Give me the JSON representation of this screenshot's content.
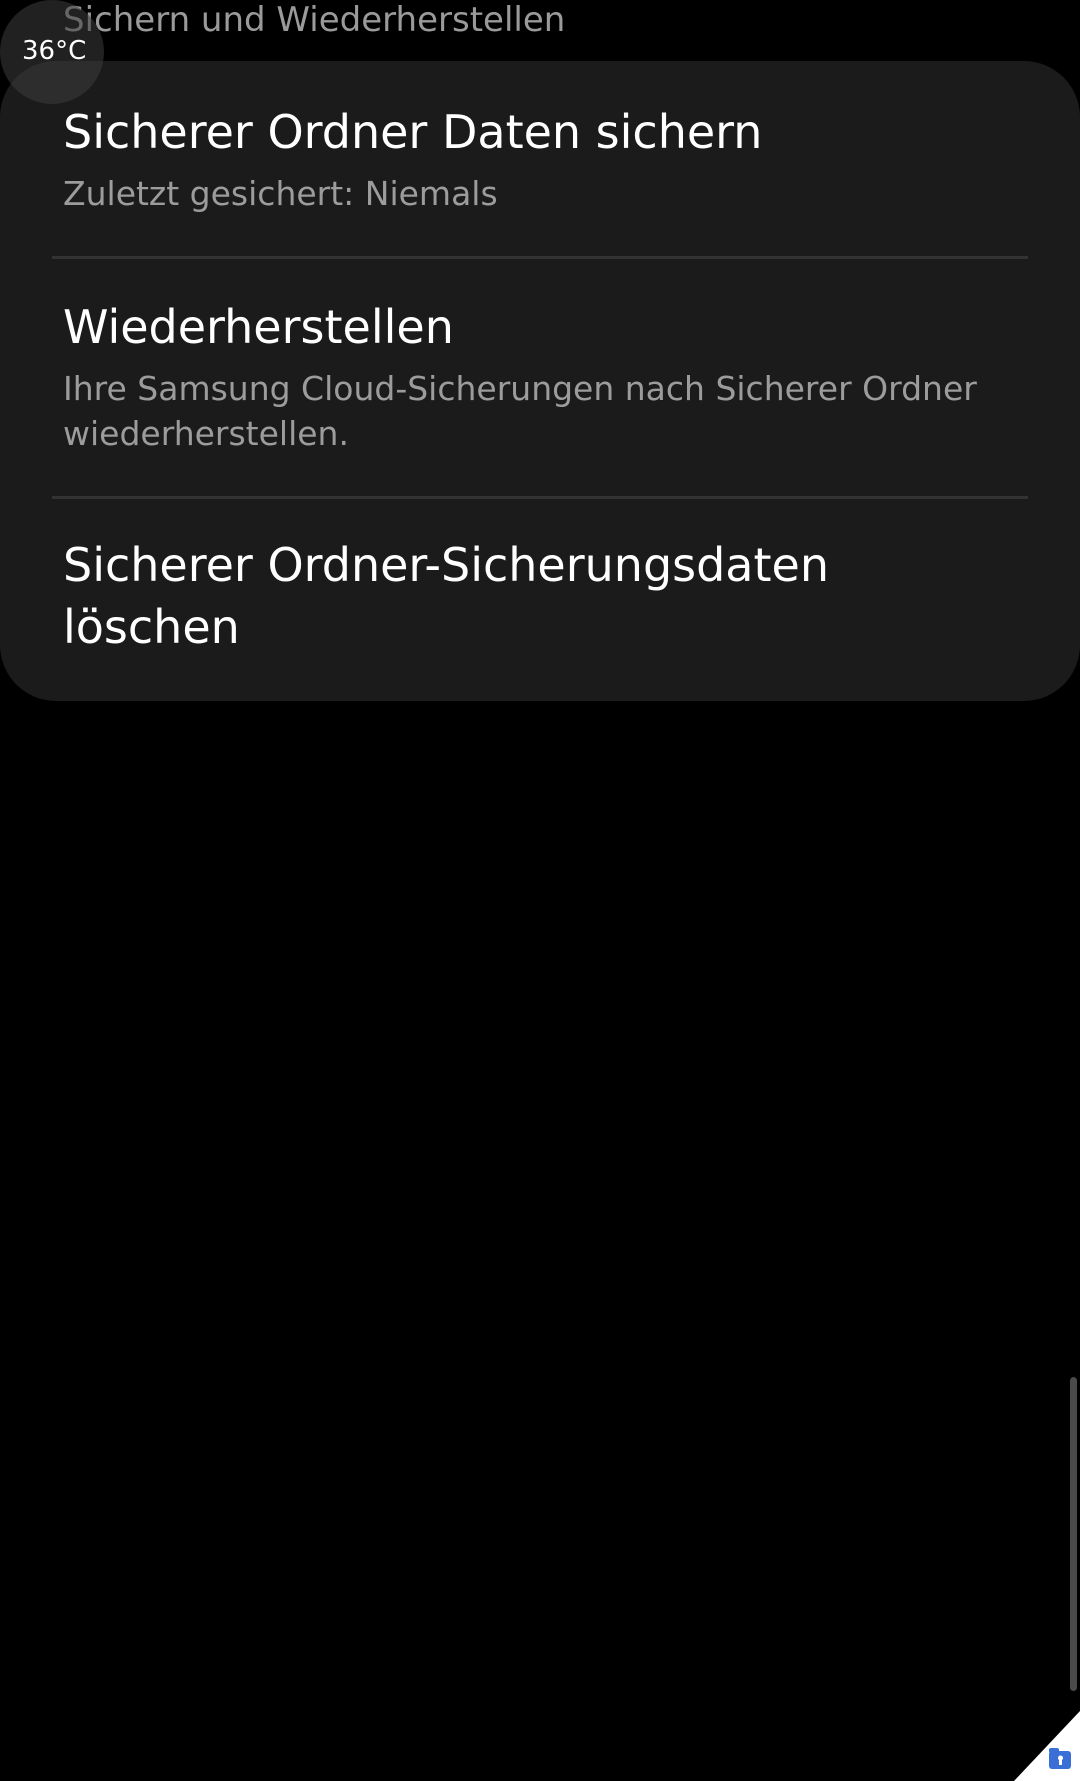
{
  "status": {
    "temperature": "36°C"
  },
  "header": {
    "title": "Sichern und Wiederherstellen"
  },
  "items": [
    {
      "title": "Sicherer Ordner Daten sichern",
      "subtitle": "Zuletzt gesichert: Niemals"
    },
    {
      "title": "Wiederherstellen",
      "subtitle": "Ihre Samsung Cloud-Sicherungen nach Sicherer Ordner wiederherstellen."
    },
    {
      "title": "Sicherer Ordner-Sicherungsdaten löschen"
    }
  ],
  "colors": {
    "background": "#000000",
    "card": "#1b1b1b",
    "divider": "#333333",
    "secondary_text": "#9c9c9c",
    "accent": "#3b6fd8"
  },
  "icons": {
    "corner": "secure-folder-icon"
  }
}
